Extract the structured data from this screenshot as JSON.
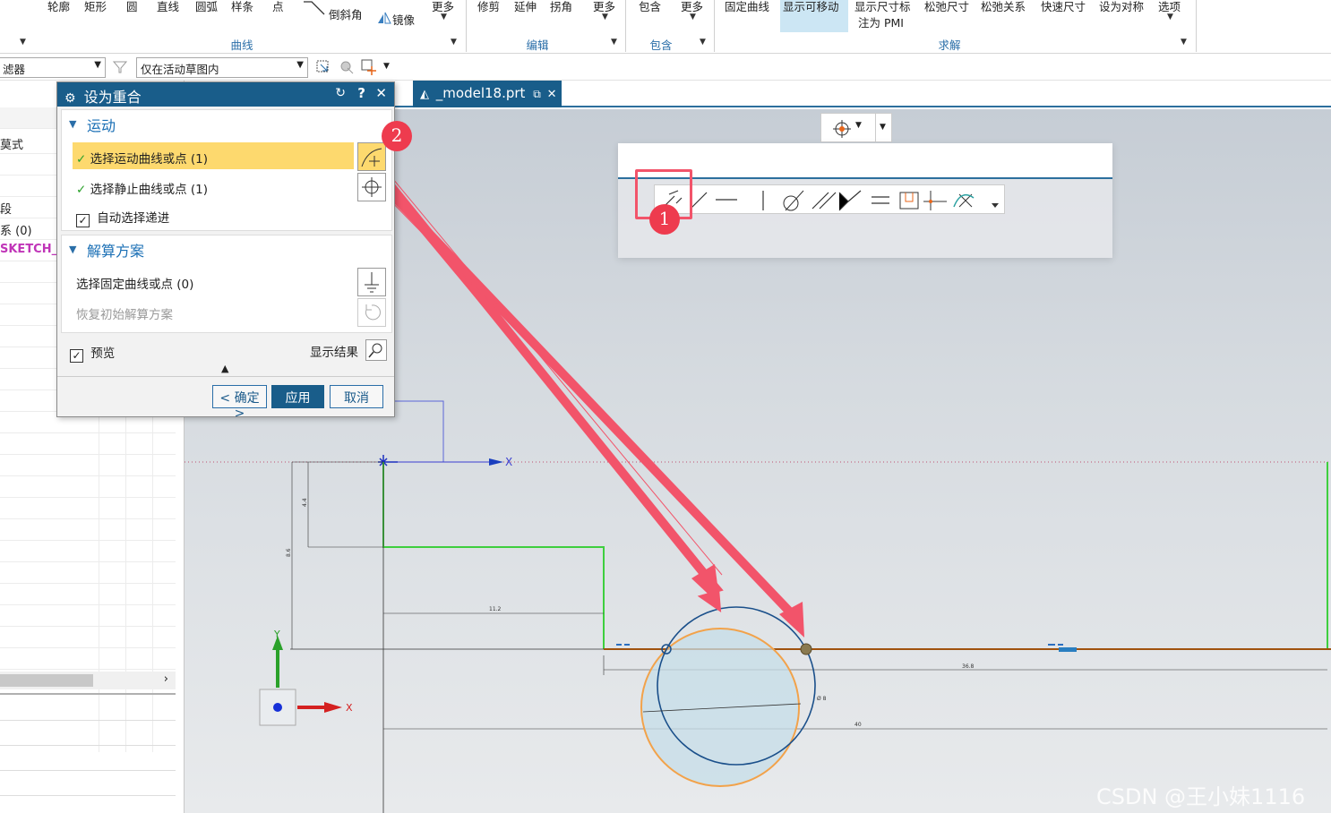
{
  "ribbon": {
    "top_labels": [
      "轮廓",
      "矩形",
      "圆",
      "直线",
      "圆弧",
      "样条",
      "点",
      "更多",
      "修剪",
      "延伸",
      "拐角",
      "更多",
      "包含",
      "更多",
      "固定曲线",
      "显示可移动",
      "显示尺寸标",
      "松弛尺寸",
      "松弛关系",
      "快速尺寸",
      "设为对称",
      "选项"
    ],
    "chamfer": "倒斜角",
    "mirror": "镜像",
    "pmi": "注为 PMI",
    "groups": [
      "曲线",
      "编辑",
      "包含",
      "求解"
    ]
  },
  "filterbar": {
    "filter_label": "滤器",
    "scope": "仅在活动草图内"
  },
  "nav": {
    "items": [
      "莫式",
      "",
      "",
      "段",
      "系 (0)",
      "SKETCH_"
    ]
  },
  "tab": {
    "title": "_model18.prt"
  },
  "dialog": {
    "title": "设为重合",
    "section_motion": "运动",
    "motion_row": "选择运动曲线或点 (1)",
    "static_row": "选择静止曲线或点 (1)",
    "auto_advance": "自动选择递进",
    "section_solve": "解算方案",
    "fixed_row": "选择固定曲线或点 (0)",
    "restore_row": "恢复初始解算方案",
    "preview": "预览",
    "show_result": "显示结果",
    "ok": "< 确定 >",
    "apply": "应用",
    "cancel": "取消"
  },
  "sketch": {
    "x_axis": "X",
    "y_axis": "Y",
    "dims": [
      "4.4",
      "8.6",
      "11.2",
      "36.8",
      "Ø 8",
      "40"
    ]
  },
  "badges": [
    "1",
    "2"
  ],
  "watermark": "CSDN @王小妹1116",
  "colors": {
    "accent": "#195d8a",
    "highlight": "#fdd96e",
    "arrow": "#f2546a",
    "profile": "#3ecf3e",
    "line_brown": "#a0520e",
    "circle_blue": "#1a4f8a",
    "circle_orange": "#f2a24a"
  }
}
